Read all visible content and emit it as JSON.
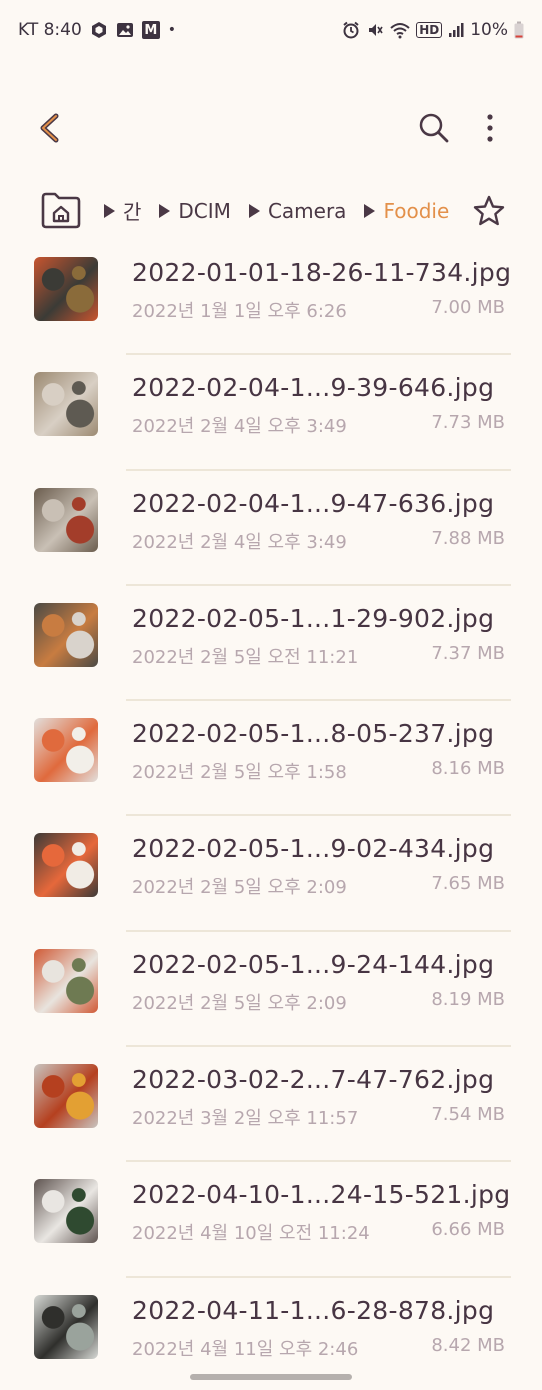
{
  "status_bar": {
    "carrier_time": "KT 8:40",
    "messenger_badge": "M",
    "dot": "•",
    "hd_badge": "HD",
    "battery": "10%"
  },
  "breadcrumb": {
    "items": [
      "간",
      "DCIM",
      "Camera"
    ],
    "current": "Foodie"
  },
  "files": [
    {
      "name": "2022-01-01-18-26-11-734.jpg",
      "date": "2022년 1월 1일 오후 6:26",
      "size": "7.00 MB",
      "thumb": [
        "#c8552f",
        "#3b3b36",
        "#8a6b3a"
      ]
    },
    {
      "name": "2022-02-04-1...9-39-646.jpg",
      "date": "2022년 2월 4일 오후 3:49",
      "size": "7.73 MB",
      "thumb": [
        "#9c8a72",
        "#d8cfc4",
        "#5e5a52"
      ]
    },
    {
      "name": "2022-02-04-1...9-47-636.jpg",
      "date": "2022년 2월 4일 오후 3:49",
      "size": "7.88 MB",
      "thumb": [
        "#6b5d4e",
        "#c9c0b5",
        "#a33d2a"
      ]
    },
    {
      "name": "2022-02-05-1...1-29-902.jpg",
      "date": "2022년 2월 5일 오전 11:21",
      "size": "7.37 MB",
      "thumb": [
        "#4b4a45",
        "#c87c41",
        "#d9d3cc"
      ]
    },
    {
      "name": "2022-02-05-1...8-05-237.jpg",
      "date": "2022년 2월 5일 오후 1:58",
      "size": "8.16 MB",
      "thumb": [
        "#e2dfdc",
        "#e06a3d",
        "#f2efe9"
      ]
    },
    {
      "name": "2022-02-05-1...9-02-434.jpg",
      "date": "2022년 2월 5일 오후 2:09",
      "size": "7.65 MB",
      "thumb": [
        "#3d3a37",
        "#e6683b",
        "#f1ece5"
      ]
    },
    {
      "name": "2022-02-05-1...9-24-144.jpg",
      "date": "2022년 2월 5일 오후 2:09",
      "size": "8.19 MB",
      "thumb": [
        "#d05a36",
        "#e8e4de",
        "#6e7a52"
      ]
    },
    {
      "name": "2022-03-02-2...7-47-762.jpg",
      "date": "2022년 3월 2일 오후 11:57",
      "size": "7.54 MB",
      "thumb": [
        "#c9c4bf",
        "#b5401f",
        "#e3a033"
      ]
    },
    {
      "name": "2022-04-10-1...24-15-521.jpg",
      "date": "2022년 4월 10일 오전 11:24",
      "size": "6.66 MB",
      "thumb": [
        "#5f5450",
        "#e9e6e2",
        "#2f4a30"
      ]
    },
    {
      "name": "2022-04-11-1...6-28-878.jpg",
      "date": "2022년 4월 11일 오후 2:46",
      "size": "8.42 MB",
      "thumb": [
        "#d7d9d5",
        "#2f2f2c",
        "#9aa39c"
      ]
    }
  ]
}
